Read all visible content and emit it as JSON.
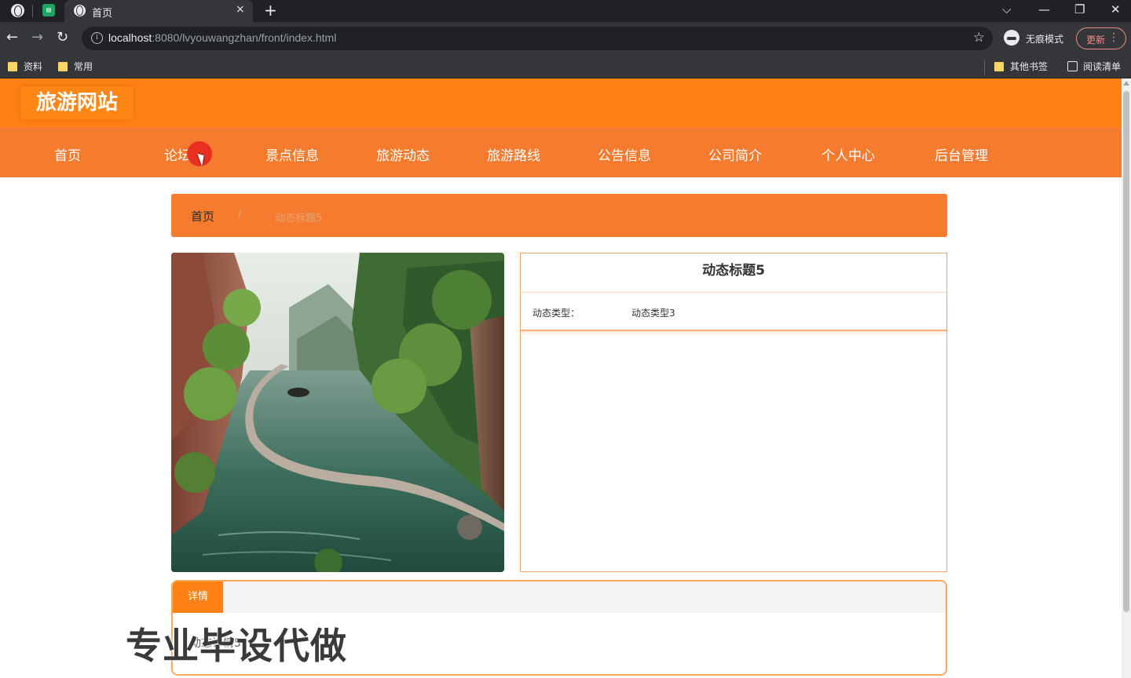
{
  "browser": {
    "tab_title": "首页",
    "tab_close": "×",
    "new_tab": "+",
    "url_host": "localhost",
    "url_rest": ":8080/lvyouwangzhan/front/index.html",
    "incognito_label": "无痕模式",
    "update_label": "更新",
    "bookmarks": [
      "资料",
      "常用"
    ],
    "other_bookmarks": "其他书签",
    "reading_list": "阅读清单"
  },
  "site": {
    "logo": "旅游网站",
    "nav": [
      "首页",
      "论坛",
      "景点信息",
      "旅游动态",
      "旅游路线",
      "公告信息",
      "公司简介",
      "个人中心",
      "后台管理"
    ]
  },
  "breadcrumb": {
    "home": "首页",
    "separator": "/",
    "current": "动态标题5"
  },
  "news": {
    "title": "动态标题5",
    "type_label": "动态类型：",
    "type_value": "动态类型3"
  },
  "detail": {
    "tab_label": "详情",
    "body": "动态详情5"
  },
  "watermark": "专业毕设代做",
  "colors": {
    "header": "#ff8114",
    "nav": "#f57b2f",
    "accent_border": "#f7a85f"
  }
}
